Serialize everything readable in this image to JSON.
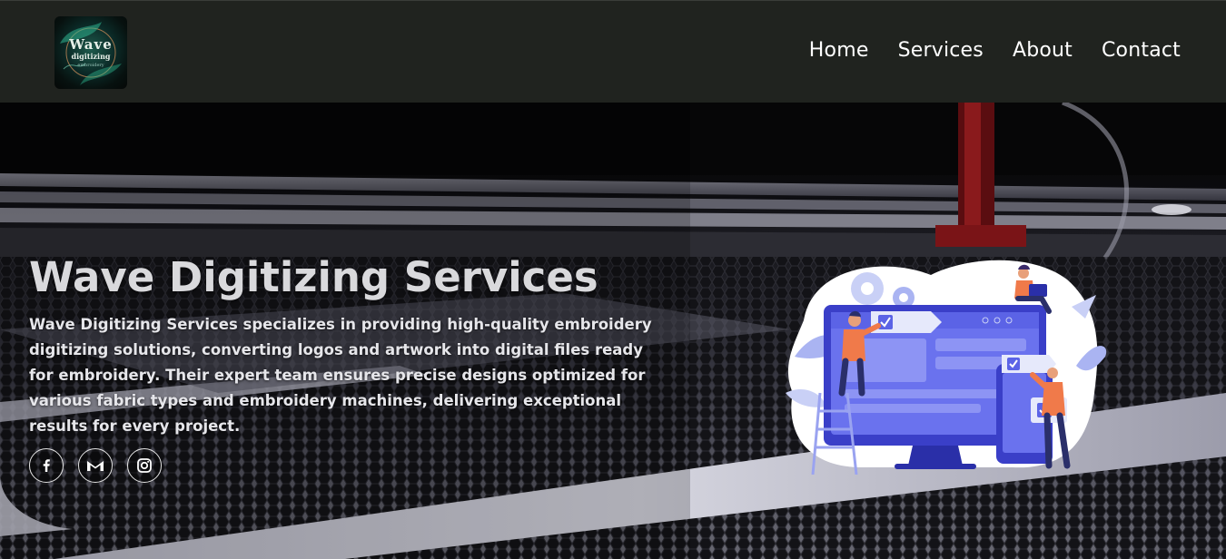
{
  "header": {
    "logo": {
      "line1": "Wave",
      "line2": "digitizing",
      "line3": "embroidery"
    },
    "nav": [
      {
        "label": "Home"
      },
      {
        "label": "Services"
      },
      {
        "label": "About"
      },
      {
        "label": "Contact"
      }
    ]
  },
  "hero": {
    "title": "Wave Digitizing Services",
    "description": "Wave Digitizing Services specializes in providing high-quality embroidery digitizing solutions, converting logos and artwork into digital files ready for embroidery. Their expert team ensures precise designs optimized for various fabric types and embroidery machines, delivering exceptional results for every project.",
    "socials": [
      {
        "icon": "facebook-icon"
      },
      {
        "icon": "gmail-icon"
      },
      {
        "icon": "instagram-icon"
      }
    ]
  },
  "colors": {
    "header_bg": "#20231f",
    "nav_text": "#ffffff",
    "title_text": "#d9d9dc",
    "illustration_accent": "#5b63e6",
    "illustration_person": "#f07a4a"
  }
}
